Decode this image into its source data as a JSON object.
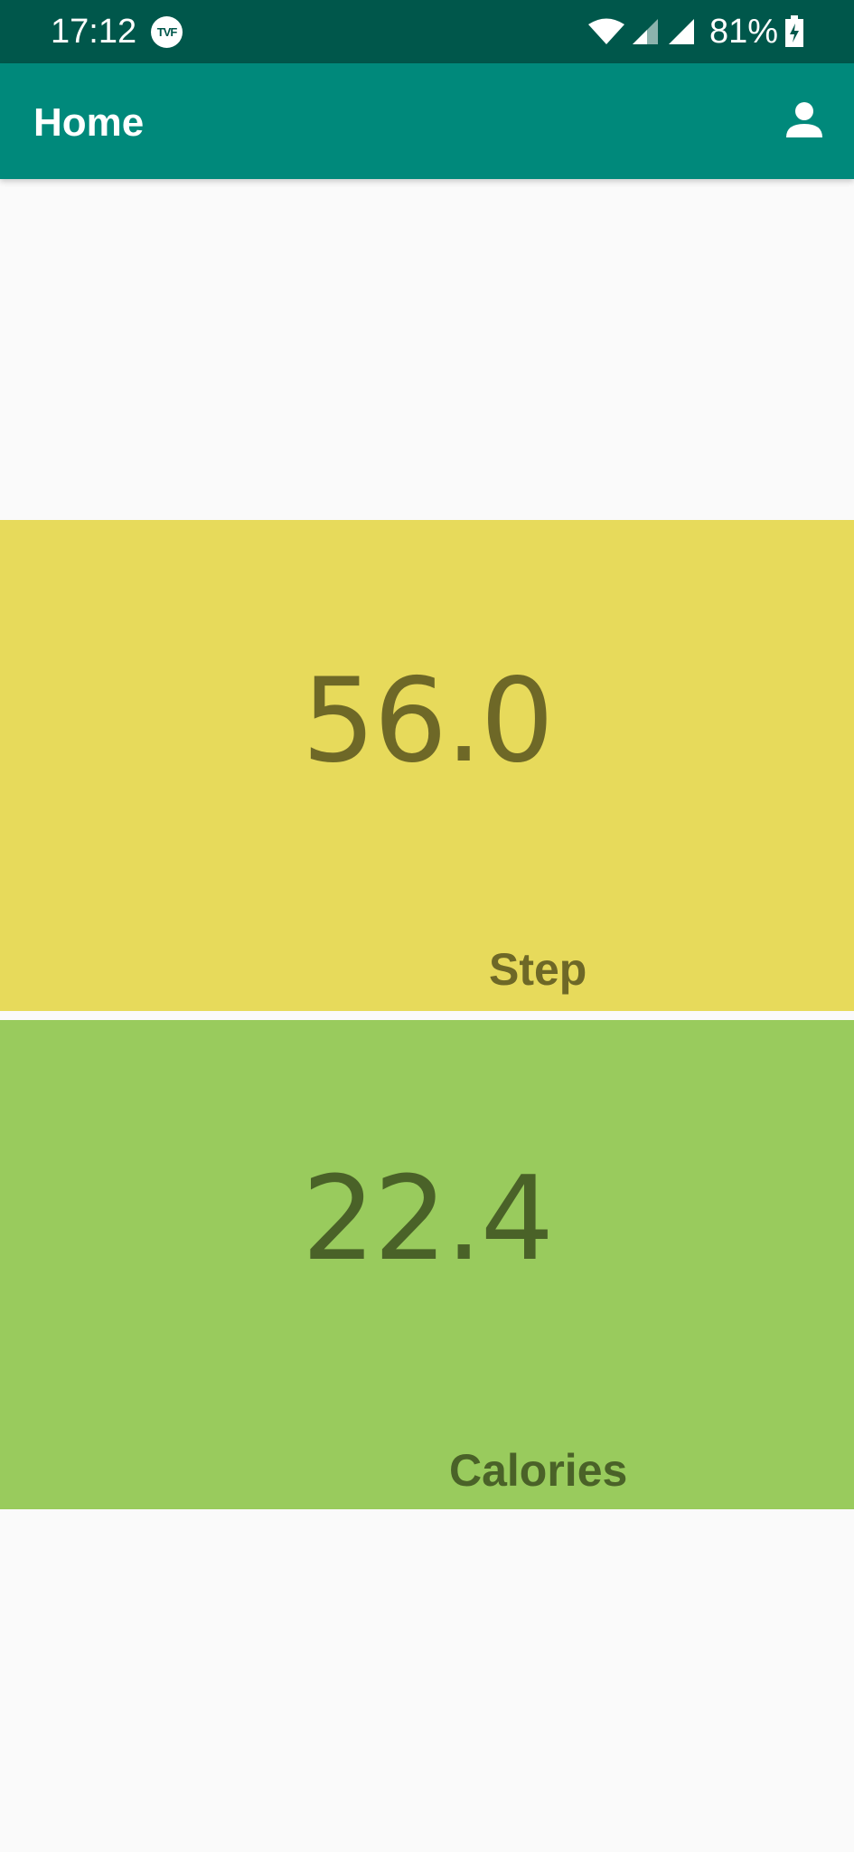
{
  "status_bar": {
    "time": "17:12",
    "notification_icon": "tvf-icon",
    "notification_icon_text": "TVF",
    "battery_percent": "81%",
    "icons": [
      "wifi-icon",
      "signal-icon",
      "signal-icon",
      "battery-charging-icon"
    ],
    "background": "#00574b"
  },
  "app_bar": {
    "title": "Home",
    "action_icon": "account-icon",
    "background": "#00897b"
  },
  "metrics": {
    "steps": {
      "value": "56.0",
      "label": "Step",
      "background": "#e7da5b",
      "text_color": "#6e6827"
    },
    "calories": {
      "value": "22.4",
      "label": "Calories",
      "background": "#99cb5d",
      "text_color": "#4a6228"
    }
  }
}
